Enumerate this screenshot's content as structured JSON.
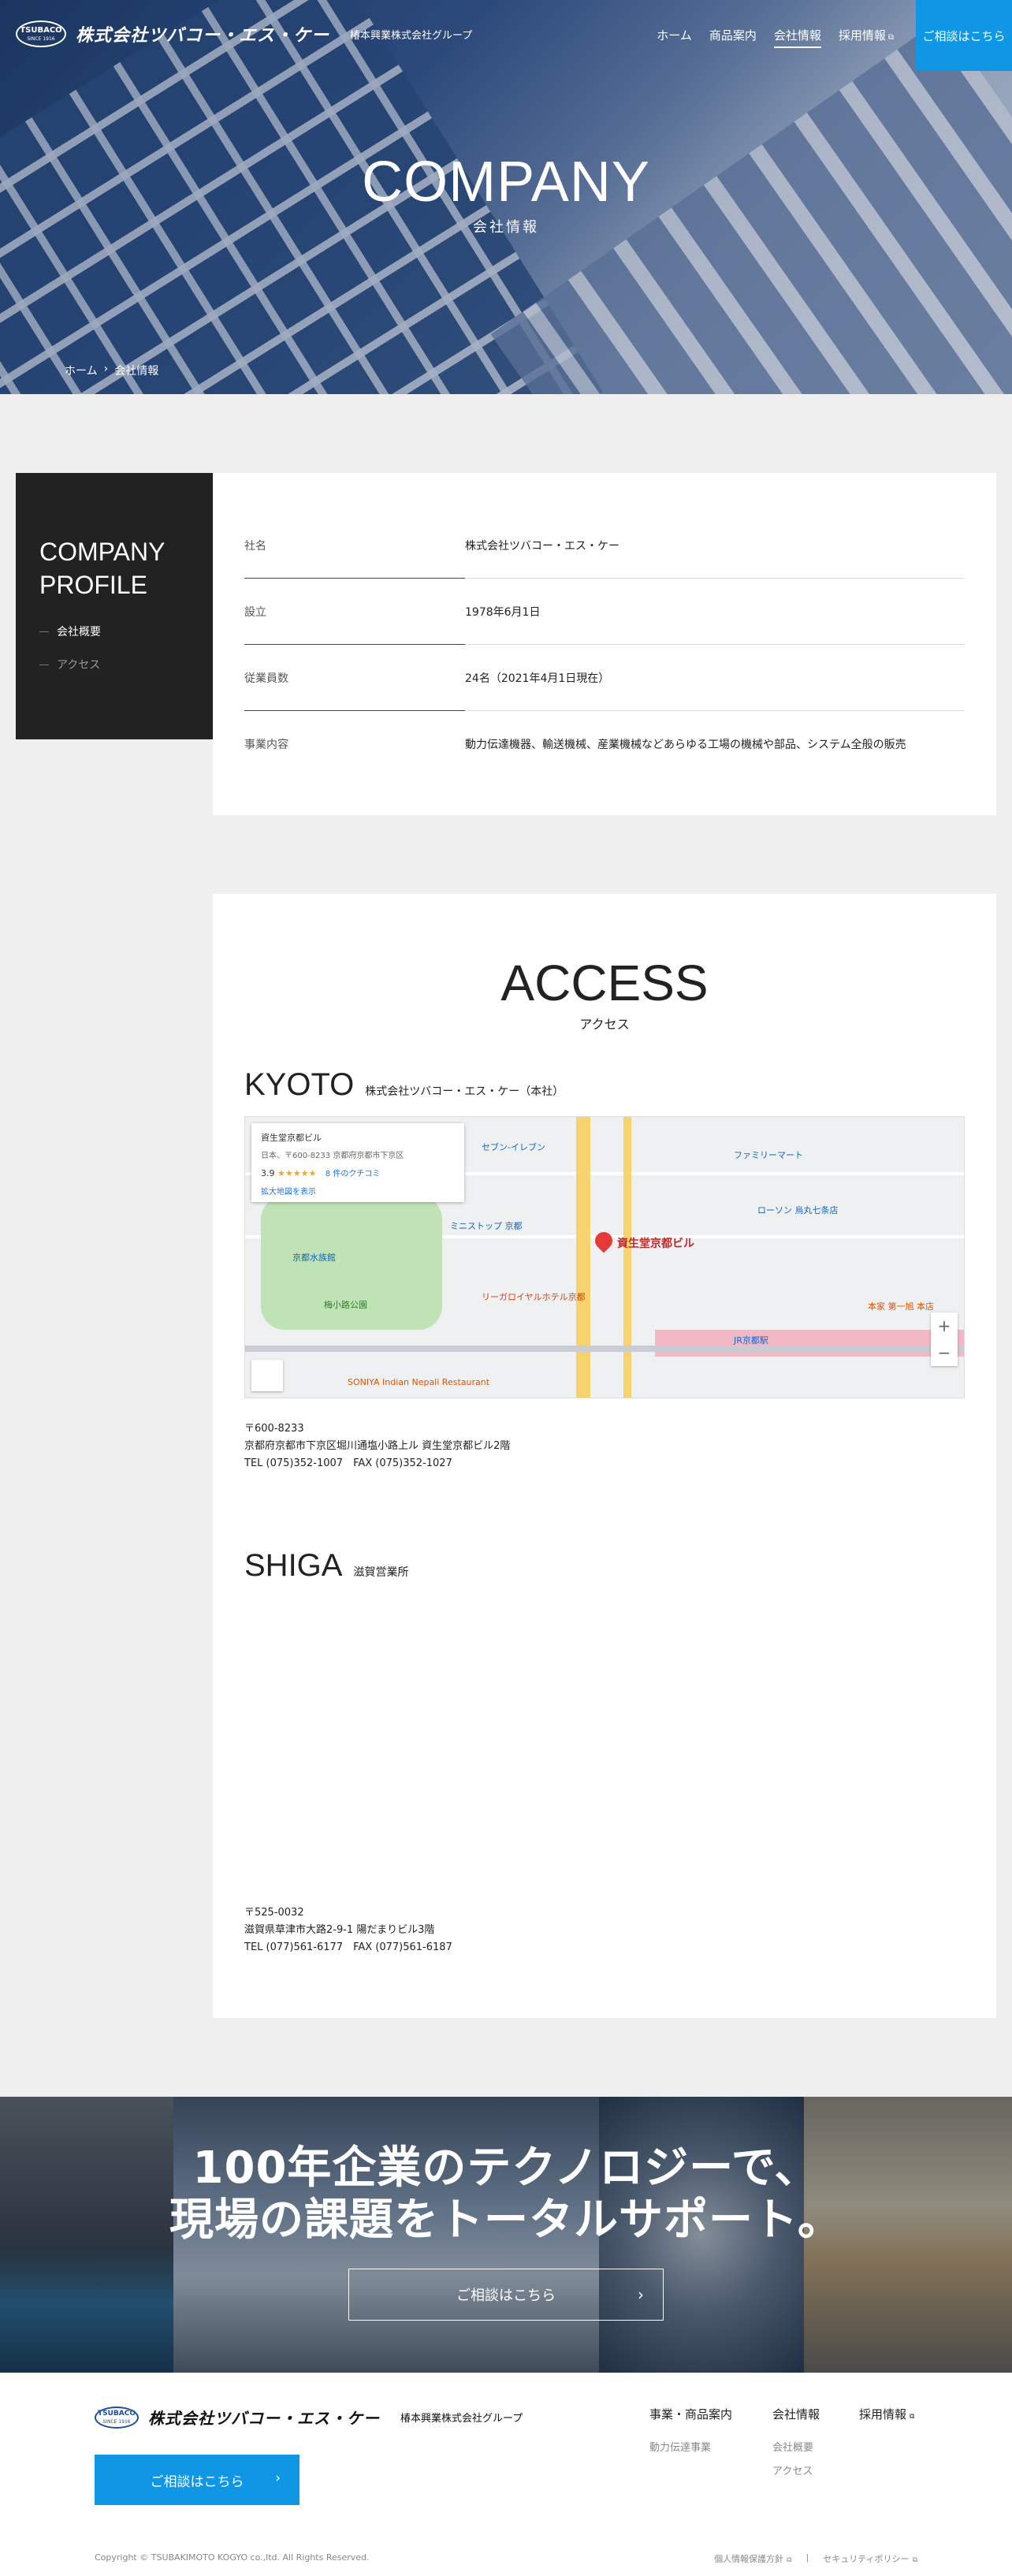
{
  "header": {
    "logo_name": "株式会社ツバコー・エス・ケー",
    "logo_mark": "TSUBACO",
    "logo_since": "SINCE 1916",
    "group": "椿本興業株式会社グループ",
    "nav": [
      {
        "label": "ホーム"
      },
      {
        "label": "商品案内"
      },
      {
        "label": "会社情報"
      },
      {
        "label": "採用情報"
      }
    ],
    "cta": "ご相談はこちら"
  },
  "hero": {
    "title": "COMPANY",
    "subtitle": "会社情報",
    "breadcrumb": [
      "ホーム",
      "会社情報"
    ]
  },
  "profile": {
    "side_title_1": "COMPANY",
    "side_title_2": "PROFILE",
    "side_links": [
      "会社概要",
      "アクセス"
    ],
    "rows": [
      {
        "label": "社名",
        "value": "株式会社ツバコー・エス・ケー"
      },
      {
        "label": "設立",
        "value": "1978年6月1日"
      },
      {
        "label": "従業員数",
        "value": "24名（2021年4月1日現在）"
      },
      {
        "label": "事業内容",
        "value": "動力伝達機器、輸送機械、産業機械などあらゆる工場の機械や部品、システム全般の販売"
      }
    ]
  },
  "access": {
    "title": "ACCESS",
    "subtitle": "アクセス",
    "offices": [
      {
        "en": "KYOTO",
        "jp": "株式会社ツバコー・エス・ケー（本社）",
        "zip": "〒600-8233",
        "address": "京都府京都市下京区堀川通塩小路上ル 資生堂京都ビル2階",
        "tel": "TEL (075)352-1007　FAX (075)352-1027"
      },
      {
        "en": "SHIGA",
        "jp": "滋賀営業所",
        "zip": "〒525-0032",
        "address": "滋賀県草津市大路2-9-1 陽だまりビル3階",
        "tel": "TEL (077)561-6177　FAX (077)561-6187"
      }
    ],
    "map": {
      "info_name": "資生堂京都ビル",
      "info_addr": "日本、〒600-8233 京都府京都市下京区",
      "rating": "3.9",
      "stars": "★★★★★",
      "reviews": "8 件のクチコミ",
      "large_map": "拡大地図を表示",
      "pin_label": "資生堂京都ビル",
      "labels": [
        "セブン-イレブン",
        "ファミリーマート",
        "ローソン 烏丸七条店",
        "梅小路公園",
        "京都水族館",
        "リーガロイヤルホテル京都",
        "JR京都駅",
        "ミニストップ 京都",
        "本家 第一旭 本店",
        "SONIYA Indian Nepali Restaurant"
      ],
      "zoom_in": "+",
      "zoom_out": "−"
    }
  },
  "banner": {
    "line1": "100年企業のテクノロジーで、",
    "line2": "現場の課題をトータルサポート。",
    "button": "ご相談はこちら"
  },
  "footer": {
    "logo_name": "株式会社ツバコー・エス・ケー",
    "group": "椿本興業株式会社グループ",
    "cta": "ご相談はこちら",
    "col1_title": "事業・商品案内",
    "col1_items": [
      "動力伝達事業"
    ],
    "col2_title": "会社情報",
    "col2_items": [
      "会社概要",
      "アクセス"
    ],
    "col3_title": "採用情報",
    "copyright": "Copyright © TSUBAKIMOTO KOGYO co.,ltd. All Rights Reserved.",
    "policy": "個人情報保護方針",
    "security": "セキュリティポリシー"
  }
}
